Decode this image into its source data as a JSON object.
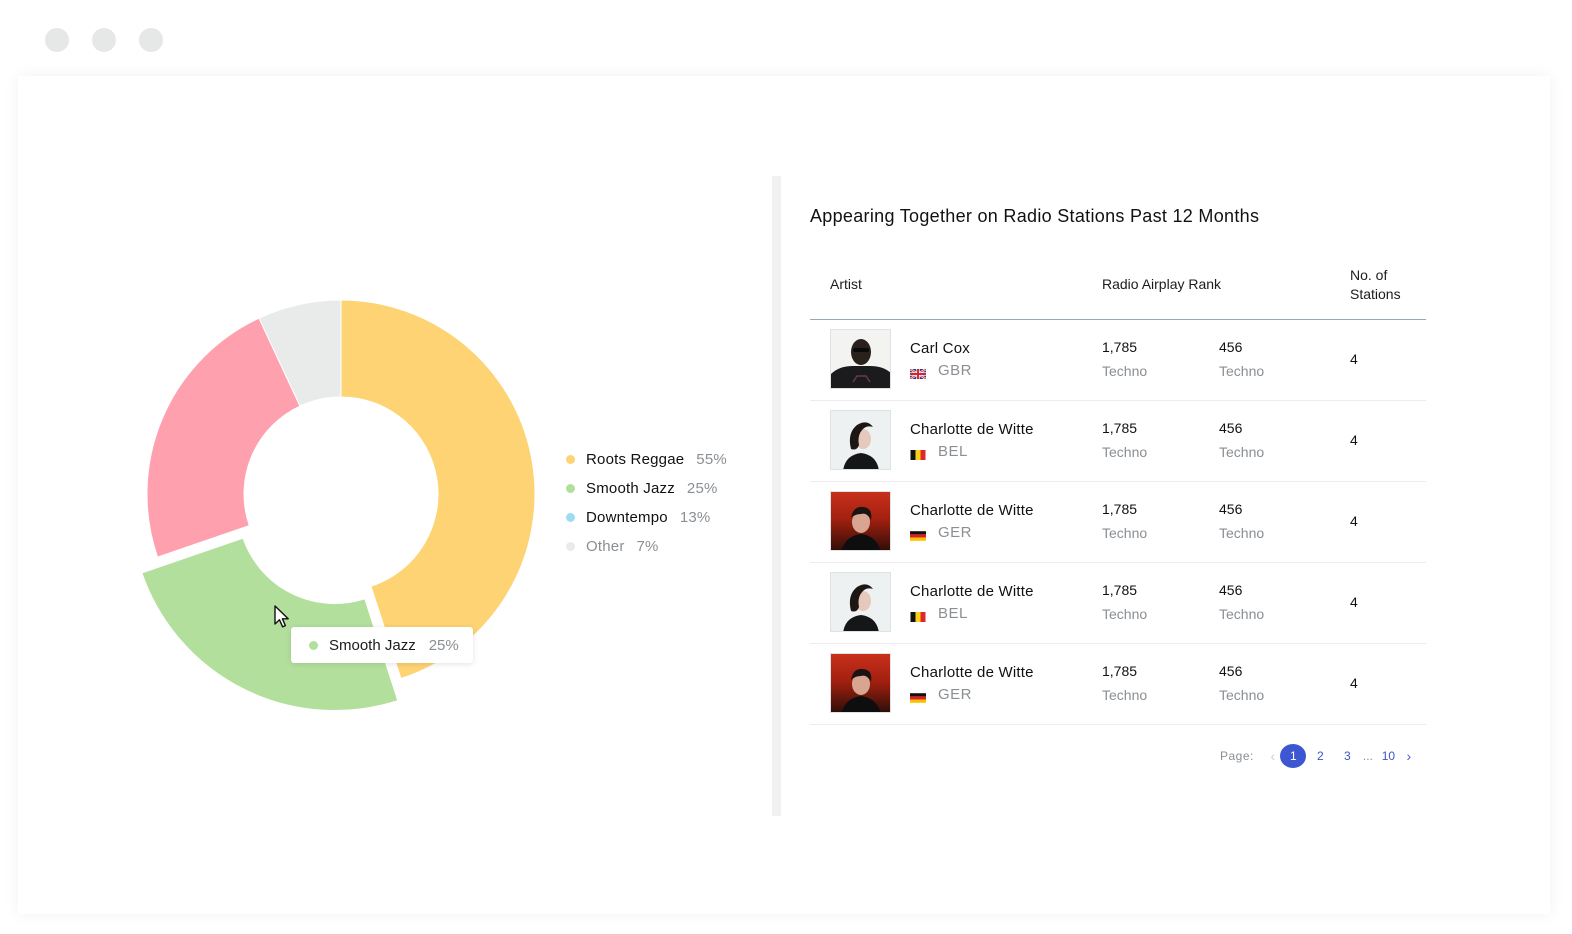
{
  "colors": {
    "roots_reggae": "#fdd373",
    "smooth_jazz": "#b3df9c",
    "downtempo": "#9fdcf0",
    "other": "#e8ebea",
    "pink_slice": "#ffa0af",
    "accent": "#3d57d2"
  },
  "chart_data": {
    "type": "pie",
    "donut": true,
    "slices": [
      {
        "label": "Roots Reggae",
        "value": 55,
        "display": "55%"
      },
      {
        "label": "Smooth Jazz",
        "value": 25,
        "display": "25%"
      },
      {
        "label": "Downtempo",
        "value": 13,
        "display": "13%"
      },
      {
        "label": "Other",
        "value": 7,
        "display": "7%"
      }
    ],
    "legend_position": "right",
    "highlighted": "Smooth Jazz"
  },
  "tooltip": {
    "label": "Smooth Jazz",
    "pct": "25%"
  },
  "table": {
    "title": "Appearing Together on Radio Stations Past 12 Months",
    "headers": {
      "artist": "Artist",
      "rank": "Radio Airplay Rank",
      "stations_line1": "No. of",
      "stations_line2": "Stations"
    },
    "rows": [
      {
        "name": "Carl Cox",
        "country": "GBR",
        "flag": "gbr",
        "rank1": "1,785",
        "genre1": "Techno",
        "rank2": "456",
        "genre2": "Techno",
        "stations": "4"
      },
      {
        "name": "Charlotte de Witte",
        "country": "BEL",
        "flag": "bel",
        "rank1": "1,785",
        "genre1": "Techno",
        "rank2": "456",
        "genre2": "Techno",
        "stations": "4"
      },
      {
        "name": "Charlotte de Witte",
        "country": "GER",
        "flag": "ger",
        "rank1": "1,785",
        "genre1": "Techno",
        "rank2": "456",
        "genre2": "Techno",
        "stations": "4"
      },
      {
        "name": "Charlotte de Witte",
        "country": "BEL",
        "flag": "bel",
        "rank1": "1,785",
        "genre1": "Techno",
        "rank2": "456",
        "genre2": "Techno",
        "stations": "4"
      },
      {
        "name": "Charlotte de Witte",
        "country": "GER",
        "flag": "ger",
        "rank1": "1,785",
        "genre1": "Techno",
        "rank2": "456",
        "genre2": "Techno",
        "stations": "4"
      }
    ]
  },
  "pagination": {
    "label": "Page:",
    "prev_icon": "‹",
    "next_icon": "›",
    "pages": [
      "1",
      "2",
      "3"
    ],
    "ellipsis": "...",
    "last": "10",
    "current": "1"
  }
}
